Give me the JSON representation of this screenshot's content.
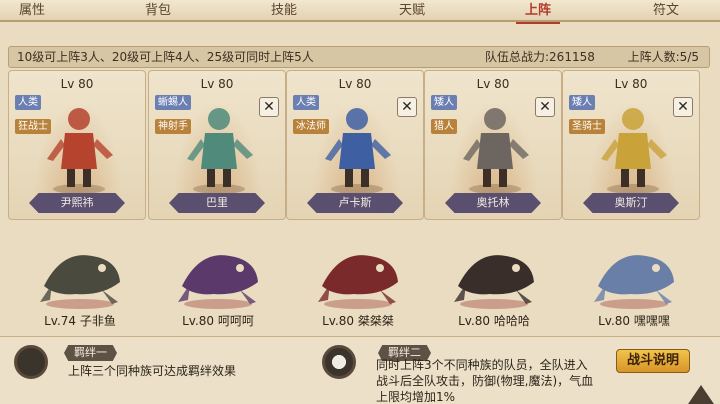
{
  "tabs": [
    {
      "label": "属性",
      "active": false
    },
    {
      "label": "背包",
      "active": false
    },
    {
      "label": "技能",
      "active": false
    },
    {
      "label": "天赋",
      "active": false
    },
    {
      "label": "上阵",
      "active": true
    },
    {
      "label": "符文",
      "active": false
    }
  ],
  "info": {
    "rule": "10级可上阵3人、20级可上阵4人、25级可同时上阵5人",
    "power": "队伍总战力:261158",
    "count": "上阵人数:5/5"
  },
  "heroes": [
    {
      "level": "Lv 80",
      "race": "人类",
      "cls": "狂战士",
      "name": "尹熙祎",
      "removable": false,
      "color": "#b5432e"
    },
    {
      "level": "Lv 80",
      "race": "蜥蜴人",
      "cls": "神射手",
      "name": "巴里",
      "removable": true,
      "color": "#4f8a7a"
    },
    {
      "level": "Lv 80",
      "race": "人类",
      "cls": "冰法师",
      "name": "卢卡斯",
      "removable": true,
      "color": "#3f5fa3"
    },
    {
      "level": "Lv 80",
      "race": "矮人",
      "cls": "猎人",
      "name": "奥托林",
      "removable": true,
      "color": "#6d6660"
    },
    {
      "level": "Lv 80",
      "race": "矮人",
      "cls": "圣骑士",
      "name": "奥斯汀",
      "removable": true,
      "color": "#c9a23a"
    }
  ],
  "close_glyph": "✕",
  "pets": [
    {
      "label": "Lv.74 子非鱼",
      "color": "#4b4a3e"
    },
    {
      "label": "Lv.80 呵呵呵",
      "color": "#5b3a6b"
    },
    {
      "label": "Lv.80 桀桀桀",
      "color": "#7a2a2a"
    },
    {
      "label": "Lv.80 哈哈哈",
      "color": "#3a2e2a"
    },
    {
      "label": "Lv.80 嘿嘿嘿",
      "color": "#6a7fa8"
    }
  ],
  "bonds": {
    "bond1": {
      "title": "羁绊一",
      "text": "上阵三个同种族可达成羁绊效果"
    },
    "bond2": {
      "title": "羁绊二",
      "line1": "同时上阵3个不同种族的队员，全队进入",
      "line2": "战斗后全队攻击，防御(物理,魔法)，气血",
      "line3": "上限均增加1%"
    },
    "battle_button": "战斗说明"
  }
}
